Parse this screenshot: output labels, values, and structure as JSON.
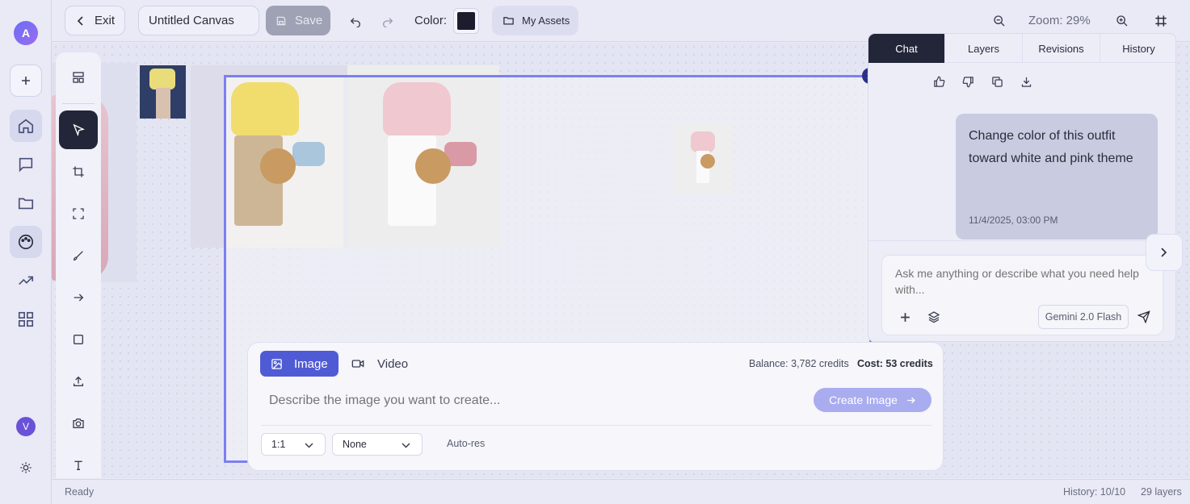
{
  "app": {
    "avatar_letter": "A",
    "user_letter": "V"
  },
  "toolbar": {
    "exit_label": "Exit",
    "canvas_name": "Untitled Canvas",
    "save_label": "Save",
    "color_label": "Color:",
    "color_value": "#1c1c2e",
    "assets_label": "My Assets",
    "zoom_label": "Zoom: 29%"
  },
  "sidebar": {
    "items": [
      "add",
      "home",
      "chat",
      "folder",
      "palette",
      "trending",
      "apps",
      "settings"
    ]
  },
  "tools": [
    "layout",
    "select",
    "crop",
    "frame",
    "brush",
    "arrow",
    "rectangle",
    "upload",
    "camera",
    "text"
  ],
  "generator": {
    "tab_image": "Image",
    "tab_video": "Video",
    "balance": "Balance: 3,782 credits",
    "cost": "Cost: 53 credits",
    "prompt_placeholder": "Describe the image you want to create...",
    "create_label": "Create Image",
    "aspect": "1:1",
    "style": "None",
    "autores": "Auto-res"
  },
  "panel": {
    "tabs": [
      "Chat",
      "Layers",
      "Revisions",
      "History"
    ],
    "active_tab": "Chat",
    "message": "Change color of this outfit toward white and pink theme",
    "timestamp": "11/4/2025, 03:00 PM",
    "input_placeholder": "Ask me anything or describe what you need help with...",
    "model": "Gemini 2.0 Flash"
  },
  "status": {
    "left": "Ready",
    "history": "History: 10/10",
    "layers": "29 layers"
  },
  "colors": {
    "accent": "#4f5bd5",
    "selection": "#7c80f0",
    "dark_tab": "#232638"
  }
}
